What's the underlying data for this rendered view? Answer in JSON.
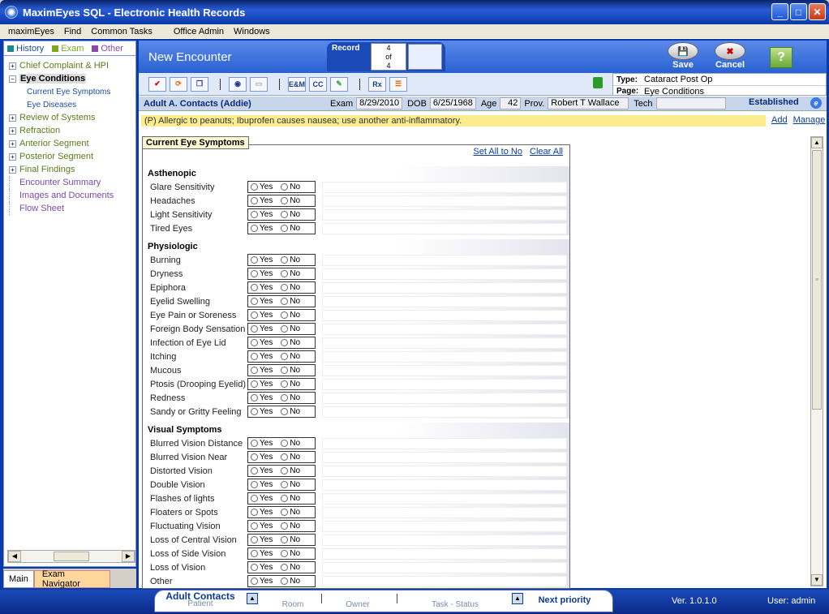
{
  "window": {
    "title": "MaximEyes SQL - Electronic Health Records"
  },
  "menu": [
    "maximEyes",
    "Find",
    "Common Tasks",
    "Office Admin",
    "Windows"
  ],
  "left_tabs": [
    {
      "label": "History",
      "color": "#1a8a8a"
    },
    {
      "label": "Exam",
      "color": "#7aaa1a"
    },
    {
      "label": "Other",
      "color": "#8a4aa8"
    }
  ],
  "tree": [
    {
      "label": "Chief Complaint & HPI",
      "pm": "+"
    },
    {
      "label": "Eye Conditions",
      "pm": "−",
      "selected": true
    },
    {
      "label": "Current Eye Symptoms",
      "sub": true
    },
    {
      "label": "Eye Diseases",
      "sub": true
    },
    {
      "label": "Review of Systems",
      "pm": "+"
    },
    {
      "label": "Refraction",
      "pm": "+"
    },
    {
      "label": "Anterior Segment",
      "pm": "+"
    },
    {
      "label": "Posterior Segment",
      "pm": "+"
    },
    {
      "label": "Final Findings",
      "pm": "+"
    },
    {
      "label": "Encounter Summary",
      "purple": true
    },
    {
      "label": "Images and Documents",
      "purple": true
    },
    {
      "label": "Flow Sheet",
      "purple": true
    }
  ],
  "bottom_tabs": {
    "main": "Main",
    "exam": "Exam Navigator"
  },
  "header": {
    "title": "New Encounter",
    "record_label": "Record",
    "record_current": "4",
    "record_of": "of",
    "record_total": "4",
    "save": "Save",
    "cancel": "Cancel",
    "help": "?"
  },
  "toolbar": {
    "em": "E&M",
    "cc": "CC",
    "rx": "Rx"
  },
  "type_box": {
    "type_label": "Type:",
    "type_value": "Cataract Post Op",
    "page_label": "Page:",
    "page_value": "Eye Conditions"
  },
  "patient": {
    "name": "Adult A. Contacts (Addie)",
    "exam_label": "Exam",
    "exam_value": "8/29/2010",
    "dob_label": "DOB",
    "dob_value": "6/25/1968",
    "age_label": "Age",
    "age_value": "42",
    "prov_label": "Prov.",
    "prov_value": "Robert T Wallace",
    "tech_label": "Tech",
    "tech_value": "",
    "status": "Established"
  },
  "allergy": {
    "text": "(P) Allergic to peanuts; Ibuprofen causes nausea; use another anti-inflammatory.",
    "add": "Add",
    "manage": "Manage"
  },
  "form": {
    "title": "Current Eye Symptoms",
    "set_all_no": "Set All to No",
    "clear_all": "Clear All",
    "yes": "Yes",
    "no": "No",
    "groups": [
      {
        "name": "Asthenopic",
        "items": [
          "Glare Sensitivity",
          "Headaches",
          "Light Sensitivity",
          "Tired Eyes"
        ]
      },
      {
        "name": "Physiologic",
        "items": [
          "Burning",
          "Dryness",
          "Epiphora",
          "Eyelid Swelling",
          "Eye Pain or Soreness",
          "Foreign Body Sensation",
          "Infection of Eye Lid",
          "Itching",
          "Mucous",
          "Ptosis (Drooping Eyelid)",
          "Redness",
          "Sandy or Gritty Feeling"
        ]
      },
      {
        "name": "Visual Symptoms",
        "items": [
          "Blurred Vision Distance",
          "Blurred Vision Near",
          "Distorted Vision",
          "Double Vision",
          "Flashes of lights",
          "Floaters or Spots",
          "Fluctuating Vision",
          "Loss of Central Vision",
          "Loss of Side Vision",
          "Loss of Vision",
          "Other"
        ]
      }
    ]
  },
  "status": {
    "patient_name": "Adult Contacts",
    "patient_label": "Patient",
    "room_label": "Room",
    "owner_label": "Owner",
    "task_label": "Task - Status",
    "next": "Next priority",
    "version": "Ver. 1.0.1.0",
    "user": "User: admin"
  }
}
